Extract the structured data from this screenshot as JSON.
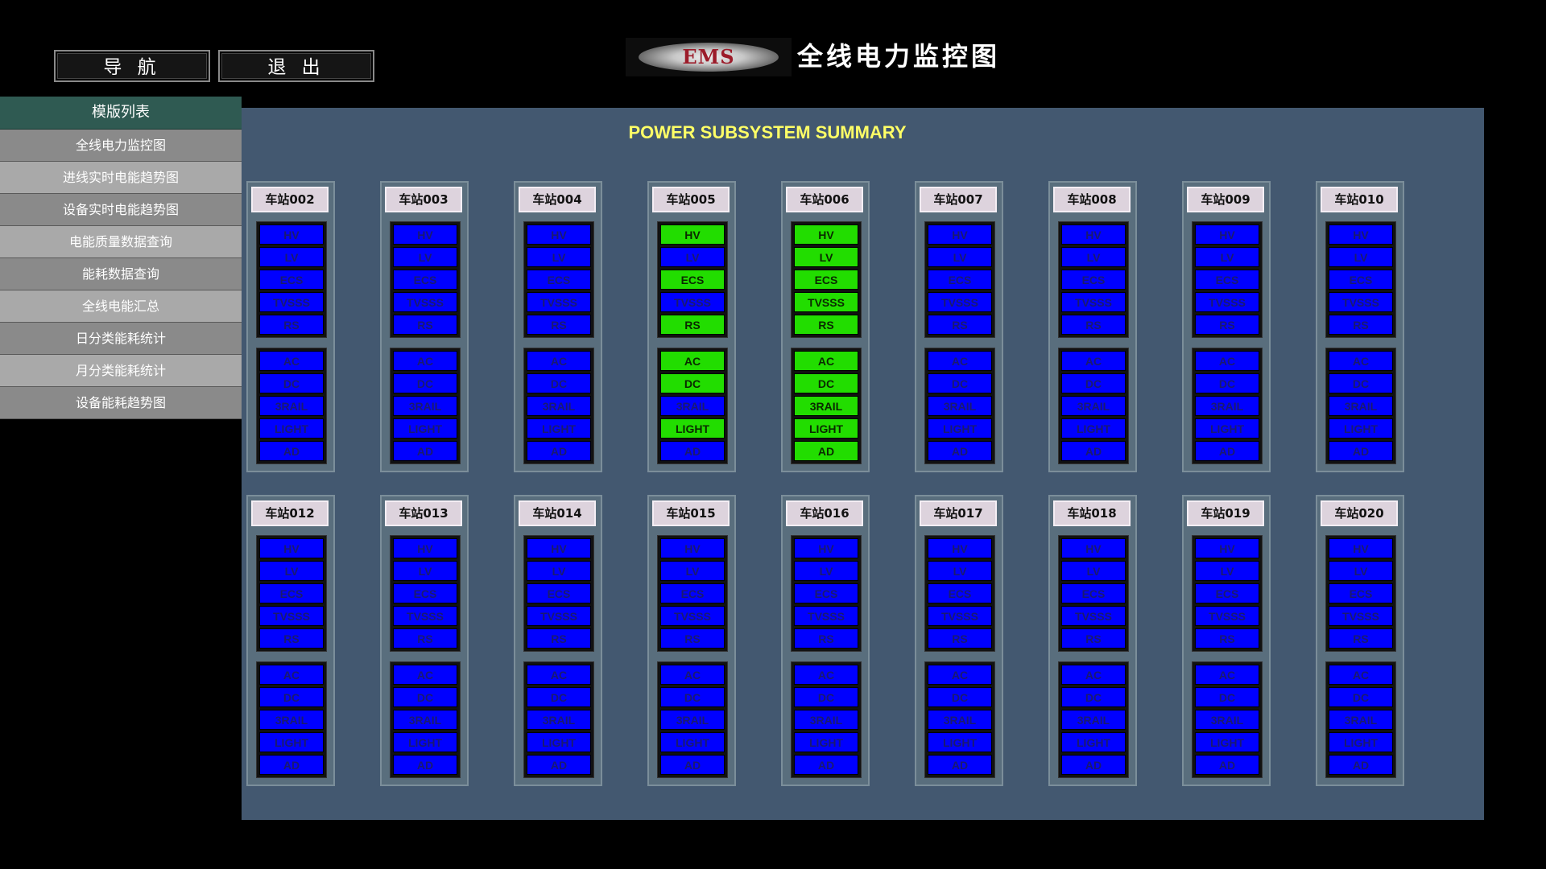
{
  "header": {
    "nav_button": "导 航",
    "exit_button": "退 出",
    "logo_text": "EMS",
    "title": "全线电力监控图"
  },
  "sidebar": {
    "title": "模版列表",
    "items": [
      {
        "label": "全线电力监控图"
      },
      {
        "label": "进线实时电能趋势图"
      },
      {
        "label": "设备实时电能趋势图"
      },
      {
        "label": "电能质量数据查询"
      },
      {
        "label": "能耗数据查询"
      },
      {
        "label": "全线电能汇总"
      },
      {
        "label": "日分类能耗统计"
      },
      {
        "label": "月分类能耗统计"
      },
      {
        "label": "设备能耗趋势图"
      }
    ]
  },
  "panel": {
    "title": "POWER SUBSYSTEM SUMMARY",
    "group1_labels": [
      "HV",
      "LV",
      "ECS",
      "TVSSS",
      "RS"
    ],
    "group2_labels": [
      "AC",
      "DC",
      "3RAIL",
      "LIGHT",
      "AD"
    ],
    "status_colors": {
      "off": "#0000ff",
      "on": "#22dd00"
    },
    "stations": [
      {
        "label": "车站002",
        "group1": [
          0,
          0,
          0,
          0,
          0
        ],
        "group2": [
          0,
          0,
          0,
          0,
          0
        ]
      },
      {
        "label": "车站003",
        "group1": [
          0,
          0,
          0,
          0,
          0
        ],
        "group2": [
          0,
          0,
          0,
          0,
          0
        ]
      },
      {
        "label": "车站004",
        "group1": [
          0,
          0,
          0,
          0,
          0
        ],
        "group2": [
          0,
          0,
          0,
          0,
          0
        ]
      },
      {
        "label": "车站005",
        "group1": [
          1,
          0,
          1,
          0,
          1
        ],
        "group2": [
          1,
          1,
          0,
          1,
          0
        ]
      },
      {
        "label": "车站006",
        "group1": [
          1,
          1,
          1,
          1,
          1
        ],
        "group2": [
          1,
          1,
          1,
          1,
          1
        ]
      },
      {
        "label": "车站007",
        "group1": [
          0,
          0,
          0,
          0,
          0
        ],
        "group2": [
          0,
          0,
          0,
          0,
          0
        ]
      },
      {
        "label": "车站008",
        "group1": [
          0,
          0,
          0,
          0,
          0
        ],
        "group2": [
          0,
          0,
          0,
          0,
          0
        ]
      },
      {
        "label": "车站009",
        "group1": [
          0,
          0,
          0,
          0,
          0
        ],
        "group2": [
          0,
          0,
          0,
          0,
          0
        ]
      },
      {
        "label": "车站010",
        "group1": [
          0,
          0,
          0,
          0,
          0
        ],
        "group2": [
          0,
          0,
          0,
          0,
          0
        ]
      },
      {
        "label": "车站012",
        "group1": [
          0,
          0,
          0,
          0,
          0
        ],
        "group2": [
          0,
          0,
          0,
          0,
          0
        ]
      },
      {
        "label": "车站013",
        "group1": [
          0,
          0,
          0,
          0,
          0
        ],
        "group2": [
          0,
          0,
          0,
          0,
          0
        ]
      },
      {
        "label": "车站014",
        "group1": [
          0,
          0,
          0,
          0,
          0
        ],
        "group2": [
          0,
          0,
          0,
          0,
          0
        ]
      },
      {
        "label": "车站015",
        "group1": [
          0,
          0,
          0,
          0,
          0
        ],
        "group2": [
          0,
          0,
          0,
          0,
          0
        ]
      },
      {
        "label": "车站016",
        "group1": [
          0,
          0,
          0,
          0,
          0
        ],
        "group2": [
          0,
          0,
          0,
          0,
          0
        ]
      },
      {
        "label": "车站017",
        "group1": [
          0,
          0,
          0,
          0,
          0
        ],
        "group2": [
          0,
          0,
          0,
          0,
          0
        ]
      },
      {
        "label": "车站018",
        "group1": [
          0,
          0,
          0,
          0,
          0
        ],
        "group2": [
          0,
          0,
          0,
          0,
          0
        ]
      },
      {
        "label": "车站019",
        "group1": [
          0,
          0,
          0,
          0,
          0
        ],
        "group2": [
          0,
          0,
          0,
          0,
          0
        ]
      },
      {
        "label": "车站020",
        "group1": [
          0,
          0,
          0,
          0,
          0
        ],
        "group2": [
          0,
          0,
          0,
          0,
          0
        ]
      }
    ]
  }
}
